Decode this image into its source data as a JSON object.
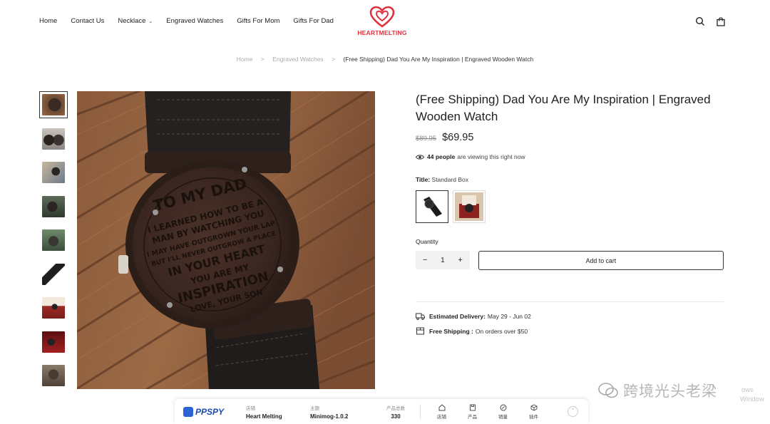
{
  "nav": {
    "items": [
      {
        "label": "Home"
      },
      {
        "label": "Contact Us"
      },
      {
        "label": "Necklace",
        "has_dropdown": true
      },
      {
        "label": "Engraved Watches"
      },
      {
        "label": "Gifts For Mom"
      },
      {
        "label": "Gifts For Dad"
      }
    ],
    "logo_text": "HEARTMELTING",
    "icons": [
      "search-icon",
      "bag-icon"
    ]
  },
  "breadcrumb": {
    "items": [
      "Home",
      "Engraved Watches"
    ],
    "current": "(Free Shipping) Dad You Are My Inspiration | Engraved Wooden Watch",
    "separator": ">"
  },
  "product": {
    "title": "(Free Shipping) Dad You Are My Inspiration | Engraved Wooden Watch",
    "old_price": "$89.95",
    "price": "$69.95",
    "viewers_count": "44 people",
    "viewers_text": "are viewing this right now",
    "variant_label": "Title:",
    "variant_value": "Standard Box",
    "quantity_label": "Quantity",
    "quantity_value": "1",
    "qty_minus": "−",
    "qty_plus": "+",
    "add_to_cart": "Add to cart",
    "delivery_label": "Estimated Delivery:",
    "delivery_value": "May 29 - Jun 02",
    "shipping_label": "Free Shipping :",
    "shipping_value": "On orders over $50"
  },
  "engraving_text": [
    "TO MY DAD",
    "I LEARNED HOW TO BE A",
    "MAN BY WATCHING YOU",
    "I MAY HAVE OUTGROWN YOUR LAP",
    "BUT I'LL NEVER OUTGROW A PLACE",
    "IN YOUR HEART",
    "YOU ARE MY",
    "INSPIRATION",
    "LOVE, YOUR SON"
  ],
  "ppspy": {
    "brand": "PPSPY",
    "store_label": "店铺",
    "store_value": "Heart Melting",
    "theme_label": "主题",
    "theme_value": "Minimog-1.0.2",
    "count_label": "产品总数",
    "count_value": "330",
    "tabs": [
      {
        "label": "店铺",
        "icon": "store-icon"
      },
      {
        "label": "产品",
        "icon": "product-icon"
      },
      {
        "label": "销量",
        "icon": "sales-icon"
      },
      {
        "label": "插件",
        "icon": "plugin-icon"
      }
    ]
  },
  "watermark": {
    "text": "跨境光头老梁",
    "windows_line1": "ows",
    "windows_line2": "Window"
  },
  "colors": {
    "brand_red": "#e0303e",
    "wood": "#8a5a3a",
    "watch_face": "#3a2720",
    "ppspy_blue": "#2a63d8"
  }
}
